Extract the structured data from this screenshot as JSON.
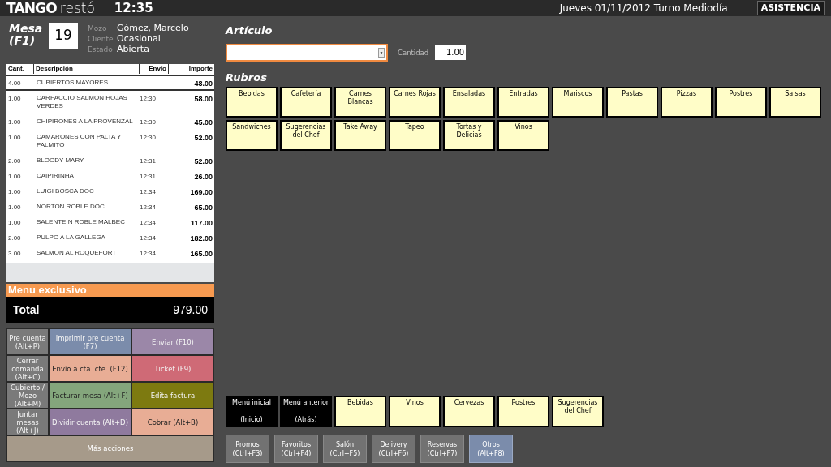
{
  "header": {
    "logo_bold": "TANGO",
    "logo_light": "restó",
    "time": "12:35",
    "date_shift": "Jueves 01/11/2012 Turno Mediodía",
    "assist_button": "ASISTENCIA"
  },
  "table_info": {
    "title": "Mesa (F1)",
    "number": "19",
    "fields": [
      {
        "label": "Mozo",
        "value": "Gómez, Marcelo"
      },
      {
        "label": "Cliente",
        "value": "Ocasional"
      },
      {
        "label": "Estado",
        "value": "Abierta"
      }
    ]
  },
  "order": {
    "columns": [
      "Cant.",
      "Descripción",
      "Envío",
      "Importe"
    ],
    "rows": [
      {
        "qty": "4.00",
        "description": "CUBIERTOS MAYORES",
        "sent": "",
        "amount": "48.00"
      },
      {
        "qty": "1.00",
        "description": "CARPACCIO SALMON HOJAS VERDES",
        "sent": "12:30",
        "amount": "58.00"
      },
      {
        "qty": "1.00",
        "description": "CHIPIRONES A LA PROVENZAL",
        "sent": "12:30",
        "amount": "45.00"
      },
      {
        "qty": "1.00",
        "description": "CAMARONES CON PALTA Y PALMITO",
        "sent": "12:30",
        "amount": "52.00"
      },
      {
        "qty": "2.00",
        "description": "BLOODY MARY",
        "sent": "12:31",
        "amount": "52.00"
      },
      {
        "qty": "1.00",
        "description": "CAIPIRINHA",
        "sent": "12:31",
        "amount": "26.00"
      },
      {
        "qty": "1.00",
        "description": "LUIGI BOSCA DOC",
        "sent": "12:34",
        "amount": "169.00"
      },
      {
        "qty": "1.00",
        "description": "NORTON ROBLE DOC",
        "sent": "12:34",
        "amount": "65.00"
      },
      {
        "qty": "1.00",
        "description": "SALENTEIN ROBLE MALBEC",
        "sent": "12:34",
        "amount": "117.00"
      },
      {
        "qty": "2.00",
        "description": "PULPO A LA GALLEGA",
        "sent": "12:34",
        "amount": "182.00"
      },
      {
        "qty": "3.00",
        "description": "SALMON AL ROQUEFORT",
        "sent": "12:34",
        "amount": "165.00"
      }
    ],
    "banner": "Menu exclusivo",
    "total_label": "Total",
    "total": "979.00"
  },
  "actions": [
    {
      "label": "Pre cuenta (Alt+P)",
      "color": "#7a7a7a"
    },
    {
      "label": "Imprimir pre cuenta (F7)",
      "color": "#7b8cab"
    },
    {
      "label": "Enviar (F10)",
      "color": "#9b87a8"
    },
    {
      "label": "Cerrar comanda (Alt+C)",
      "color": "#7a7a7a"
    },
    {
      "label": "Envío a cta. cte. (F12)",
      "color": "#e8ad95"
    },
    {
      "label": "Ticket (F9)",
      "color": "#cf6a76"
    },
    {
      "label": "Cubierto / Mozo (Alt+M)",
      "color": "#7a7a7a"
    },
    {
      "label": "Facturar mesa (Alt+F)",
      "color": "#84a67c"
    },
    {
      "label": "Edita factura",
      "color": "#7d7a10"
    },
    {
      "label": "Juntar mesas (Alt+J)",
      "color": "#7a7a7a"
    },
    {
      "label": "Dividir cuenta (Alt+D)",
      "color": "#8f7a9e"
    },
    {
      "label": "Cobrar (Alt+B)",
      "color": "#e8ad95"
    }
  ],
  "more_actions": "Más acciones",
  "article": {
    "title": "Artículo",
    "quantity_label": "Cantidad",
    "quantity": "1.00"
  },
  "categories": {
    "title": "Rubros",
    "items": [
      "Bebidas",
      "Cafetería",
      "Carnes Blancas",
      "Carnes Rojas",
      "Ensaladas",
      "Entradas",
      "Mariscos",
      "Pastas",
      "Pizzas",
      "Postres",
      "Salsas",
      "Sandwiches",
      "Sugerencias del Chef",
      "Take Away",
      "Tapeo",
      "Tortas y Delicias",
      "Vinos"
    ]
  },
  "quick_menu": [
    {
      "kind": "nav",
      "label": "Menú inicial",
      "key": "(Inicio)"
    },
    {
      "kind": "nav",
      "label": "Menú anterior",
      "key": "(Atrás)"
    },
    {
      "kind": "item",
      "label": "Bebidas"
    },
    {
      "kind": "item",
      "label": "Vinos"
    },
    {
      "kind": "item",
      "label": "Cervezas"
    },
    {
      "kind": "item",
      "label": "Postres"
    },
    {
      "kind": "item",
      "label": "Sugerencias del Chef"
    }
  ],
  "sections": [
    {
      "label": "Promos (Ctrl+F3)",
      "selected": false
    },
    {
      "label": "Favoritos (Ctrl+F4)",
      "selected": false
    },
    {
      "label": "Salón (Ctrl+F5)",
      "selected": false
    },
    {
      "label": "Delivery (Ctrl+F6)",
      "selected": false
    },
    {
      "label": "Reservas (Ctrl+F7)",
      "selected": false
    },
    {
      "label": "Otros (Alt+F8)",
      "selected": true
    }
  ]
}
